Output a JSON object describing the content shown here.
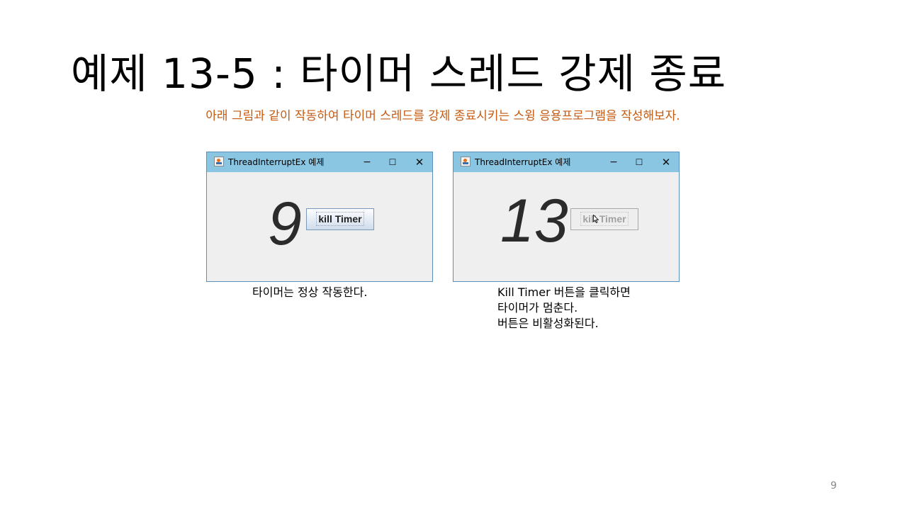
{
  "slide": {
    "title": "예제 13-5 : 타이머 스레드  강제 종료",
    "subtitle": "아래 그림과 같이 작동하여 타이머 스레드를 강제 종료시키는 스윙 응용프로그램을 작성해보자.",
    "page_number": "9"
  },
  "colors": {
    "subtitle": "#c55a11",
    "titlebar": "#8ac5e2",
    "window_body": "#efefef"
  },
  "windows": [
    {
      "title": "ThreadInterruptEx 예제",
      "count": "9",
      "button_label": "kill Timer",
      "button_enabled": true,
      "controls": {
        "minimize": "−",
        "maximize": "☐",
        "close": "✕"
      },
      "caption_lines": [
        "타이머는 정상 작동한다."
      ]
    },
    {
      "title": "ThreadInterruptEx 예제",
      "count": "13",
      "button_label": "kill Timer",
      "button_enabled": false,
      "controls": {
        "minimize": "−",
        "maximize": "☐",
        "close": "✕"
      },
      "caption_lines": [
        "Kill Timer 버튼을 클릭하면",
        "타이머가 멈춘다.",
        "버튼은 비활성화된다."
      ]
    }
  ],
  "icons": {
    "app_icon": "java-app-icon",
    "cursor": "mouse-pointer-icon"
  }
}
